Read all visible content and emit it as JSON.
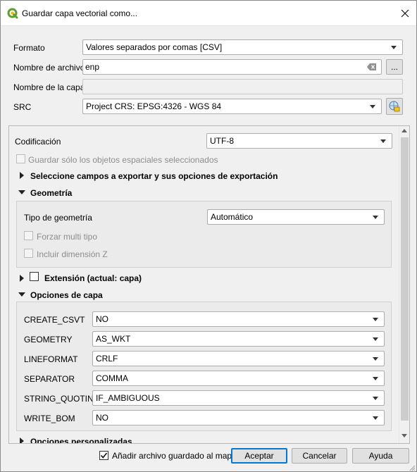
{
  "window": {
    "title": "Guardar capa vectorial como..."
  },
  "form": {
    "format_label": "Formato",
    "format_value": "Valores separados por comas [CSV]",
    "filename_label": "Nombre de archivo",
    "filename_value": "enp",
    "browse_label": "...",
    "layername_label": "Nombre de la capa",
    "layername_value": "",
    "crs_label": "SRC",
    "crs_value": "Project CRS: EPSG:4326 - WGS 84"
  },
  "panel": {
    "encoding_label": "Codificación",
    "encoding_value": "UTF-8",
    "selected_only_label": "Guardar sólo los objetos espaciales seleccionados",
    "fields_section": "Seleccione campos a exportar y sus opciones de exportación",
    "geometry_section": "Geometría",
    "geometry_type_label": "Tipo de geometría",
    "geometry_type_value": "Automático",
    "force_multi_label": "Forzar multi tipo",
    "include_z_label": "Incluir dimensión Z",
    "extent_section": "Extensión (actual: capa)",
    "layer_options_section": "Opciones de capa",
    "layer_options": [
      {
        "name": "CREATE_CSVT",
        "value": "NO"
      },
      {
        "name": "GEOMETRY",
        "value": "AS_WKT"
      },
      {
        "name": "LINEFORMAT",
        "value": "CRLF"
      },
      {
        "name": "SEPARATOR",
        "value": "COMMA"
      },
      {
        "name": "STRING_QUOTING",
        "value": "IF_AMBIGUOUS"
      },
      {
        "name": "WRITE_BOM",
        "value": "NO"
      }
    ],
    "custom_options_section": "Opciones personalizadas"
  },
  "footer": {
    "add_to_map_label": "Añadir archivo guardado al mapa",
    "add_to_map_checked": true,
    "accept_label": "Aceptar",
    "cancel_label": "Cancelar",
    "help_label": "Ayuda"
  },
  "colors": {
    "qgis_green": "#5c9e31",
    "accent_blue": "#0078d7"
  },
  "icons": [
    "qgis-logo-icon",
    "close-icon",
    "clear-text-icon",
    "crs-selector-icon",
    "chevron-down-icon",
    "expand-arrow-icon",
    "collapse-arrow-icon",
    "checkmark-icon"
  ]
}
